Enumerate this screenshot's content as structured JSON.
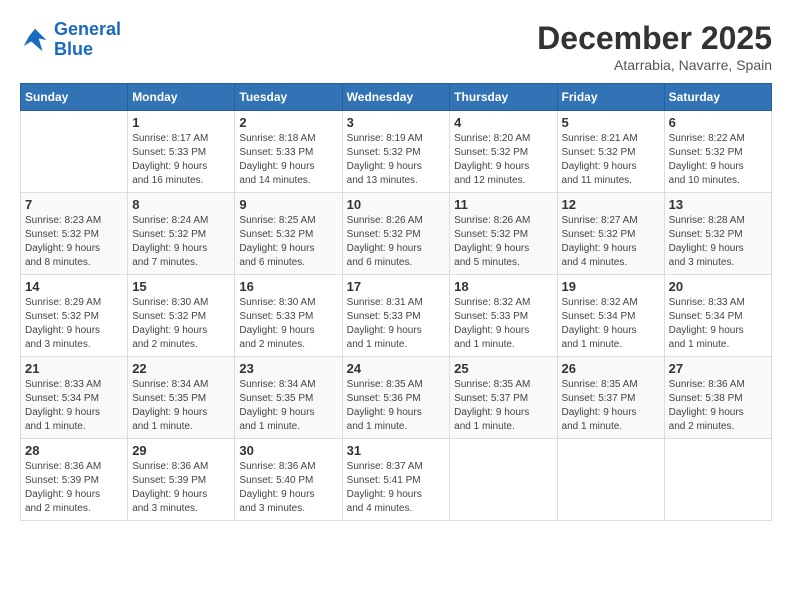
{
  "logo": {
    "general": "General",
    "blue": "Blue"
  },
  "title": {
    "month_year": "December 2025",
    "location": "Atarrabia, Navarre, Spain"
  },
  "days_of_week": [
    "Sunday",
    "Monday",
    "Tuesday",
    "Wednesday",
    "Thursday",
    "Friday",
    "Saturday"
  ],
  "weeks": [
    [
      {
        "day": "",
        "info": ""
      },
      {
        "day": "1",
        "info": "Sunrise: 8:17 AM\nSunset: 5:33 PM\nDaylight: 9 hours\nand 16 minutes."
      },
      {
        "day": "2",
        "info": "Sunrise: 8:18 AM\nSunset: 5:33 PM\nDaylight: 9 hours\nand 14 minutes."
      },
      {
        "day": "3",
        "info": "Sunrise: 8:19 AM\nSunset: 5:32 PM\nDaylight: 9 hours\nand 13 minutes."
      },
      {
        "day": "4",
        "info": "Sunrise: 8:20 AM\nSunset: 5:32 PM\nDaylight: 9 hours\nand 12 minutes."
      },
      {
        "day": "5",
        "info": "Sunrise: 8:21 AM\nSunset: 5:32 PM\nDaylight: 9 hours\nand 11 minutes."
      },
      {
        "day": "6",
        "info": "Sunrise: 8:22 AM\nSunset: 5:32 PM\nDaylight: 9 hours\nand 10 minutes."
      }
    ],
    [
      {
        "day": "7",
        "info": "Sunrise: 8:23 AM\nSunset: 5:32 PM\nDaylight: 9 hours\nand 8 minutes."
      },
      {
        "day": "8",
        "info": "Sunrise: 8:24 AM\nSunset: 5:32 PM\nDaylight: 9 hours\nand 7 minutes."
      },
      {
        "day": "9",
        "info": "Sunrise: 8:25 AM\nSunset: 5:32 PM\nDaylight: 9 hours\nand 6 minutes."
      },
      {
        "day": "10",
        "info": "Sunrise: 8:26 AM\nSunset: 5:32 PM\nDaylight: 9 hours\nand 6 minutes."
      },
      {
        "day": "11",
        "info": "Sunrise: 8:26 AM\nSunset: 5:32 PM\nDaylight: 9 hours\nand 5 minutes."
      },
      {
        "day": "12",
        "info": "Sunrise: 8:27 AM\nSunset: 5:32 PM\nDaylight: 9 hours\nand 4 minutes."
      },
      {
        "day": "13",
        "info": "Sunrise: 8:28 AM\nSunset: 5:32 PM\nDaylight: 9 hours\nand 3 minutes."
      }
    ],
    [
      {
        "day": "14",
        "info": "Sunrise: 8:29 AM\nSunset: 5:32 PM\nDaylight: 9 hours\nand 3 minutes."
      },
      {
        "day": "15",
        "info": "Sunrise: 8:30 AM\nSunset: 5:32 PM\nDaylight: 9 hours\nand 2 minutes."
      },
      {
        "day": "16",
        "info": "Sunrise: 8:30 AM\nSunset: 5:33 PM\nDaylight: 9 hours\nand 2 minutes."
      },
      {
        "day": "17",
        "info": "Sunrise: 8:31 AM\nSunset: 5:33 PM\nDaylight: 9 hours\nand 1 minute."
      },
      {
        "day": "18",
        "info": "Sunrise: 8:32 AM\nSunset: 5:33 PM\nDaylight: 9 hours\nand 1 minute."
      },
      {
        "day": "19",
        "info": "Sunrise: 8:32 AM\nSunset: 5:34 PM\nDaylight: 9 hours\nand 1 minute."
      },
      {
        "day": "20",
        "info": "Sunrise: 8:33 AM\nSunset: 5:34 PM\nDaylight: 9 hours\nand 1 minute."
      }
    ],
    [
      {
        "day": "21",
        "info": "Sunrise: 8:33 AM\nSunset: 5:34 PM\nDaylight: 9 hours\nand 1 minute."
      },
      {
        "day": "22",
        "info": "Sunrise: 8:34 AM\nSunset: 5:35 PM\nDaylight: 9 hours\nand 1 minute."
      },
      {
        "day": "23",
        "info": "Sunrise: 8:34 AM\nSunset: 5:35 PM\nDaylight: 9 hours\nand 1 minute."
      },
      {
        "day": "24",
        "info": "Sunrise: 8:35 AM\nSunset: 5:36 PM\nDaylight: 9 hours\nand 1 minute."
      },
      {
        "day": "25",
        "info": "Sunrise: 8:35 AM\nSunset: 5:37 PM\nDaylight: 9 hours\nand 1 minute."
      },
      {
        "day": "26",
        "info": "Sunrise: 8:35 AM\nSunset: 5:37 PM\nDaylight: 9 hours\nand 1 minute."
      },
      {
        "day": "27",
        "info": "Sunrise: 8:36 AM\nSunset: 5:38 PM\nDaylight: 9 hours\nand 2 minutes."
      }
    ],
    [
      {
        "day": "28",
        "info": "Sunrise: 8:36 AM\nSunset: 5:39 PM\nDaylight: 9 hours\nand 2 minutes."
      },
      {
        "day": "29",
        "info": "Sunrise: 8:36 AM\nSunset: 5:39 PM\nDaylight: 9 hours\nand 3 minutes."
      },
      {
        "day": "30",
        "info": "Sunrise: 8:36 AM\nSunset: 5:40 PM\nDaylight: 9 hours\nand 3 minutes."
      },
      {
        "day": "31",
        "info": "Sunrise: 8:37 AM\nSunset: 5:41 PM\nDaylight: 9 hours\nand 4 minutes."
      },
      {
        "day": "",
        "info": ""
      },
      {
        "day": "",
        "info": ""
      },
      {
        "day": "",
        "info": ""
      }
    ]
  ]
}
